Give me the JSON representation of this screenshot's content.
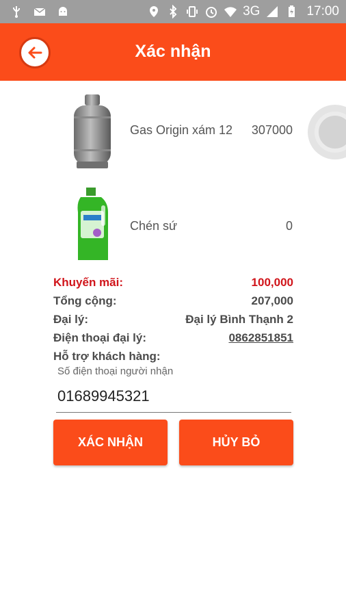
{
  "status_bar": {
    "network": "3G",
    "time": "17:00",
    "icons": [
      "usb-icon",
      "mail-icon",
      "android-icon",
      "location-icon",
      "bluetooth-icon",
      "vibrate-icon",
      "alarm-icon",
      "wifi-icon",
      "signal-icon",
      "battery-icon"
    ]
  },
  "app_bar": {
    "title": "Xác nhận",
    "back_icon": "arrow-left-icon",
    "color": "#fb4c1a"
  },
  "products": [
    {
      "name": "Gas Origin xám 12",
      "price": "307000",
      "image": "gas-cylinder-image"
    },
    {
      "name": "Chén sứ",
      "price": "0",
      "image": "cleaner-bottle-image"
    }
  ],
  "summary": {
    "promo_label": "Khuyến mãi:",
    "promo_value": "100,000",
    "total_label": "Tổng cộng:",
    "total_value": "207,000",
    "agent_label": "Đại lý:",
    "agent_value": "Đại lý Bình Thạnh 2",
    "agent_phone_label": "Điện thoại đại lý:",
    "agent_phone_value": "0862851851",
    "support_label": "Hỗ trợ khách hàng:"
  },
  "recipient": {
    "hint": "Số điện thoại người nhận",
    "value": "01689945321"
  },
  "buttons": {
    "confirm": "XÁC NHẬN",
    "cancel": "HỦY BỎ"
  }
}
